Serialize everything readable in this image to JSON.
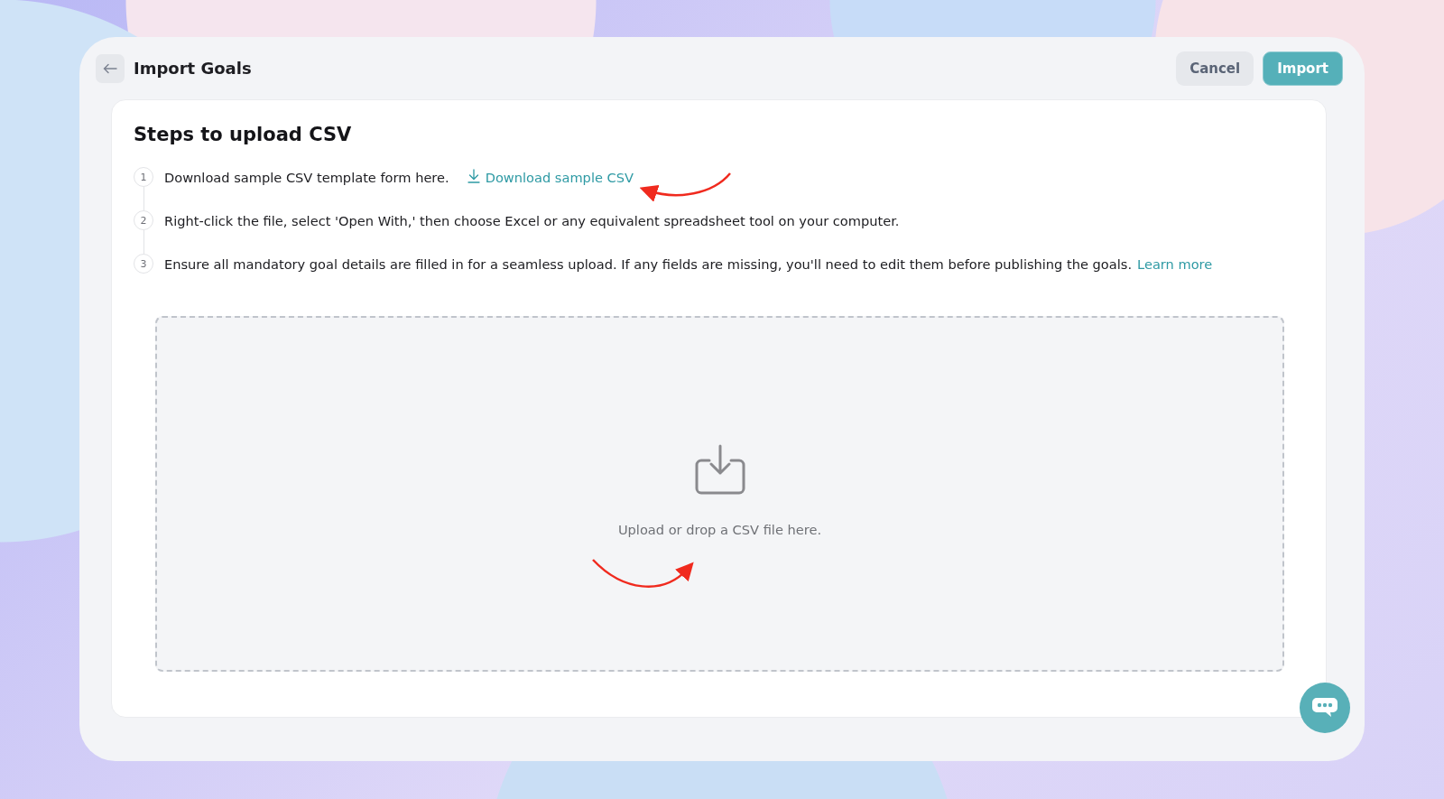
{
  "header": {
    "title": "Import Goals",
    "buttons": [
      {
        "label": "Cancel",
        "kind": "secondary"
      },
      {
        "label": "Import",
        "kind": "primary"
      }
    ]
  },
  "card": {
    "title": "Steps to upload CSV",
    "steps": [
      {
        "number": "1",
        "text": "Download sample CSV template form here.",
        "link": {
          "text": "Download sample CSV",
          "kind": "download"
        }
      },
      {
        "number": "2",
        "text": "Right-click the file, select 'Open With,' then choose Excel or any equivalent spreadsheet tool on your computer."
      },
      {
        "number": "3",
        "text": "Ensure all mandatory goal details are filled in for a seamless upload. If any fields are missing, you'll need to edit them before publishing the goals.",
        "link": {
          "text": "Learn more",
          "kind": "plain"
        }
      }
    ],
    "dropzone": {
      "text": "Upload or drop a CSV file here."
    }
  }
}
